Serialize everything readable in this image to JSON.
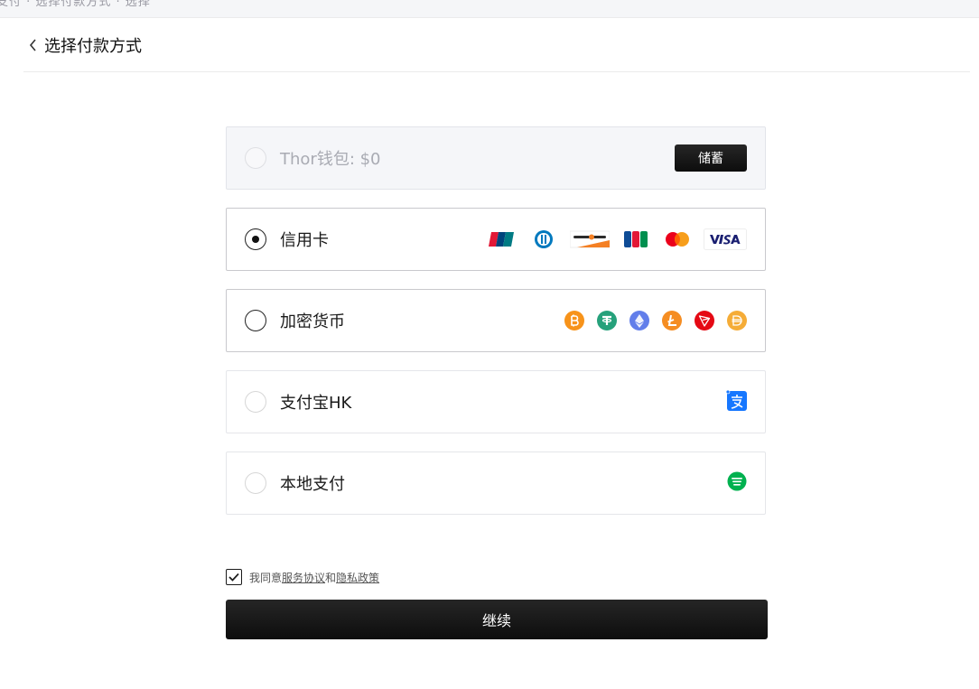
{
  "topbar": {
    "breadcrumb": "支付 · 选择付款方式 · 选择"
  },
  "header": {
    "title": "选择付款方式"
  },
  "methods": {
    "wallet": {
      "label": "Thor钱包: $0",
      "deposit_label": "储蓄"
    },
    "credit_card": {
      "label": "信用卡",
      "brands": [
        "UnionPay",
        "Diners Club",
        "DISCOVER",
        "JCB",
        "Mastercard",
        "VISA"
      ]
    },
    "crypto": {
      "label": "加密货币",
      "coins": [
        "bitcoin",
        "tether",
        "ethereum",
        "litecoin",
        "tron",
        "dai"
      ]
    },
    "alipay": {
      "label": "支付宝HK"
    },
    "local": {
      "label": "本地支付"
    }
  },
  "agreement": {
    "prefix": "我同意",
    "terms": "服务协议",
    "and": "和",
    "privacy": "隐私政策",
    "checked": true
  },
  "continue_label": "继续",
  "colors": {
    "primary": "#111111",
    "bitcoin": "#F7931A",
    "tether": "#26A17B",
    "ethereum": "#627EEA",
    "litecoin": "#F58D22",
    "tron": "#E50914",
    "dai": "#F5AC37",
    "alipay": "#1677FF",
    "grabpay": "#00B14F"
  }
}
